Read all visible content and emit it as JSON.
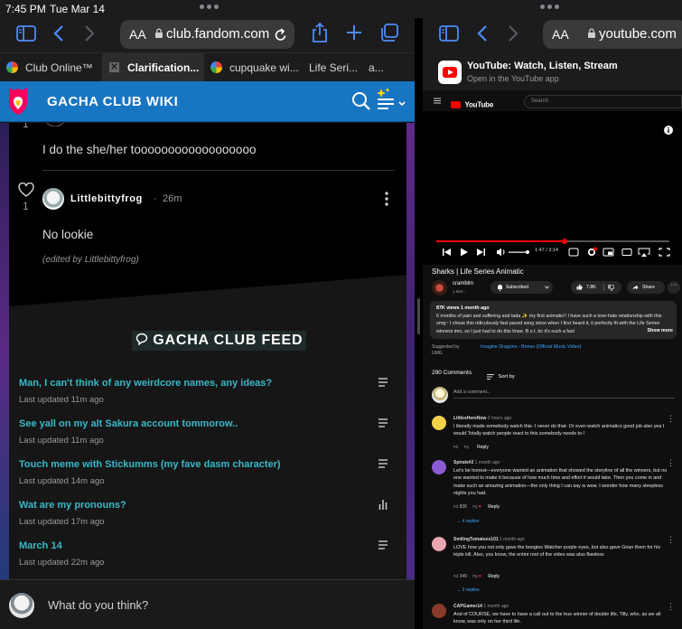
{
  "status_bar": {
    "time": "7:45 PM",
    "date": "Tue Mar 14"
  },
  "left_browser": {
    "text_size_button": "AA",
    "url": "club.fandom.com",
    "tabs": [
      {
        "label": "Club Online™",
        "icon": "google-icon"
      },
      {
        "label": "Clarification...",
        "icon": "close-icon"
      },
      {
        "label": "cupquake wi...",
        "icon": "google-icon"
      },
      {
        "label": "Life Seri...",
        "icon": "none"
      },
      {
        "label": "a...",
        "icon": "none"
      }
    ]
  },
  "wiki": {
    "title": "GACHA CLUB WIKI",
    "comments": [
      {
        "text": "I do the she/her toooooooooooooooooo",
        "like_count": "1"
      },
      {
        "username": "Littlebittyfrog",
        "time": "26m",
        "text": "No lookie",
        "edited_note": "(edited by Littlebittyfrog)",
        "like_count": "1"
      }
    ],
    "feed": {
      "title": "GACHA CLUB FEED",
      "items": [
        {
          "title": "Man, I can't think of any weirdcore names, any ideas?",
          "updated": "Last updated 11m ago",
          "icon": "text-post-icon"
        },
        {
          "title": "See yall on my alt Sakura account tommorow..",
          "updated": "Last updated 11m ago",
          "icon": "text-post-icon"
        },
        {
          "title": "Touch meme with Stickumms (my fave dasm character)",
          "updated": "Last updated 14m ago",
          "icon": "text-post-icon"
        },
        {
          "title": "Wat are my pronouns?",
          "updated": "Last updated 17m ago",
          "icon": "poll-icon"
        },
        {
          "title": "March 14",
          "updated": "Last updated 22m ago",
          "icon": "text-post-icon"
        }
      ]
    },
    "reply_placeholder": "What do you think?"
  },
  "right_browser": {
    "text_size_button": "AA",
    "url": "youtube.com",
    "app_banner": {
      "title": "YouTube: Watch, Listen, Stream",
      "subtitle": "Open in the YouTube app"
    },
    "search_placeholder": "Search",
    "logo_text": "YouTube",
    "player": {
      "time": "1:47 / 3:14",
      "progress": 0.55
    },
    "video": {
      "title": "Sharks | Life Series Animatic",
      "channel": "cramblm",
      "subscribers": "1.66K...",
      "subscribe_label": "Subscribed",
      "likes": "7.8K",
      "share_label": "Share",
      "views": "87K views",
      "age": "1 month ago",
      "description": "6 months of pain and suffering and tada ✨ my first animatic!! I have such a love-hate relationship with this omg~ I chose this ridiculously fast paced song since when I first heard it, it perfectly fit with the Life Series winners imo, so I just had to do this lmao. B u t, bc it's such a fast",
      "show_more": "Show more",
      "suggested_label": "Suggested by UMG",
      "suggested_song": "Imagine Dragons - Bones (Official Music Video)"
    },
    "comments_header": {
      "count": "290 Comments",
      "sort": "Sort by",
      "add_placeholder": "Add a comment..."
    },
    "comments": [
      {
        "author": "LittlesHereNow",
        "age": "2 hours ago",
        "text": "I literally made somebody watch this- I never do that- Or even watch animatics good job also yea I would Totally watch people react to this somebody needs to-!",
        "likes": "",
        "replies": "",
        "avatar_color": "#f3d24a"
      },
      {
        "author": "Spirals#2",
        "age": "1 month ago",
        "text": "Let's be honest—everyone wanted an animation that showed the storyline of all the winners, but no one wanted to make it because of how much time and effort it would take. Then you come in and make such an amazing animation—the only thing I can say is wow. I wonder how many sleepless nights you had.",
        "likes": "836",
        "replies": "4 replies",
        "avatar_color": "#8a5bd1"
      },
      {
        "author": "SmilingTomatoes101",
        "age": "1 month ago",
        "text": "LOVE how you not only gave the boogies Watcher purple eyes, but also gave Grian them for his triple kill. Also, you know, the entire rest of the video was also flawless",
        "likes": "349",
        "replies": "2 replies",
        "avatar_color": "#e8a6b3"
      },
      {
        "author": "CAPGamer14",
        "age": "1 month ago",
        "text": "And of COURSE, we have to have a call out to the true winner of double life, Tilly, who, as we all know, was only on her third life.",
        "likes": "",
        "replies": "",
        "avatar_color": "#8a3a2a"
      }
    ],
    "reply_label": "Reply"
  }
}
